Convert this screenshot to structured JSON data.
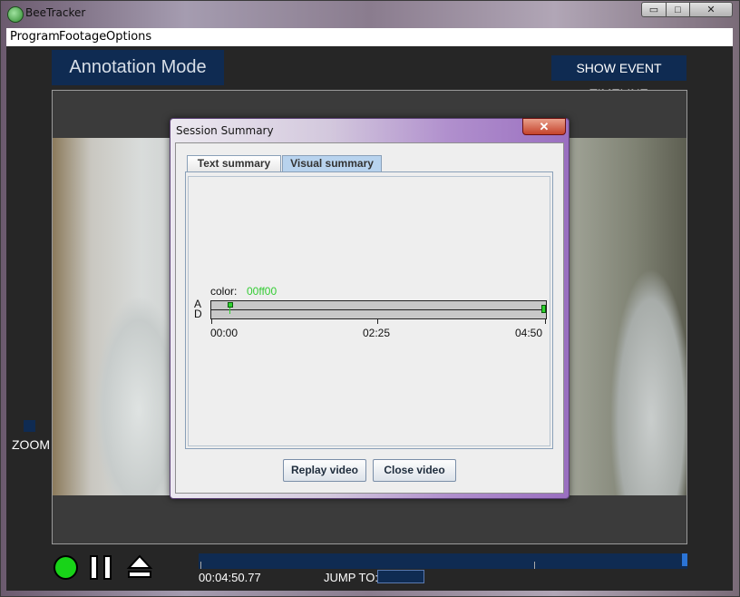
{
  "window": {
    "title": "BeeTracker",
    "controls": {
      "minimize": "▭",
      "maximize": "□",
      "close": "✕"
    }
  },
  "menu": {
    "items": [
      "Program",
      "Footage",
      "Options"
    ]
  },
  "header": {
    "mode_label": "Annotation Mode",
    "timeline_button": "SHOW EVENT TIMELINE"
  },
  "sidebar": {
    "zoom_label": "ZOOM"
  },
  "playback": {
    "time": "00:04:50.77",
    "jump_label": "JUMP TO:",
    "jump_value": "",
    "progress": 0.99
  },
  "dialog": {
    "title": "Session Summary",
    "close": "✕",
    "tabs": [
      {
        "label": "Text summary",
        "selected": false
      },
      {
        "label": "Visual summary",
        "selected": true
      }
    ],
    "visual": {
      "color_label": "color:",
      "color_value": "00ff00",
      "row_labels": [
        "A",
        "D"
      ],
      "axis_labels": [
        "00:00",
        "02:25",
        "04:50"
      ],
      "event_color": "#00ff00"
    },
    "buttons": {
      "replay": "Replay video",
      "close_video": "Close video"
    }
  },
  "colors": {
    "accent": "#0f2b52",
    "play": "#18d318",
    "event": "#2fd42f"
  }
}
